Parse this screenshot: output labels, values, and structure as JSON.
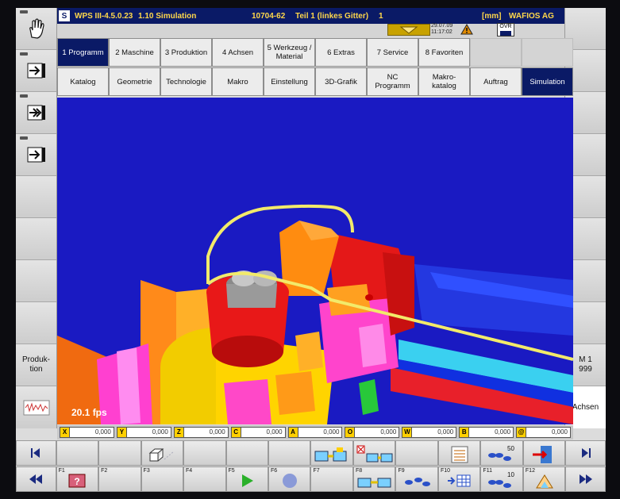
{
  "titlebar": {
    "app": "WPS III-4.5.0.23",
    "screen": "1.10 Simulation",
    "part_no": "10704-62",
    "part_name": "Teil 1 (linkes Gitter)",
    "part_index": "1",
    "unit": "[mm]",
    "company": "WAFIOS AG"
  },
  "status": {
    "date": "29.07.09",
    "time": "11:17:02",
    "ovr_label": "OVR"
  },
  "top_tabs": [
    {
      "label": "1 Programm",
      "selected": true
    },
    {
      "label": "2 Maschine"
    },
    {
      "label": "3 Produktion"
    },
    {
      "label": "4 Achsen"
    },
    {
      "label": "5 Werkzeug / Material"
    },
    {
      "label": "6 Extras"
    },
    {
      "label": "7 Service"
    },
    {
      "label": "8 Favoriten"
    }
  ],
  "sub_tabs": [
    {
      "label": "Katalog"
    },
    {
      "label": "Geometrie"
    },
    {
      "label": "Technologie"
    },
    {
      "label": "Makro"
    },
    {
      "label": "Einstellung"
    },
    {
      "label": "3D-Grafik"
    },
    {
      "label": "NC Programm"
    },
    {
      "label": "Makro-katalog"
    },
    {
      "label": "Auftrag"
    },
    {
      "label": "Simulation",
      "selected": true
    }
  ],
  "left_softkeys": [
    {
      "icon": "hand-icon"
    },
    {
      "icon": "step-forward-icon"
    },
    {
      "icon": "double-step-icon"
    },
    {
      "icon": "arrow-in-icon"
    },
    {
      "label": ""
    },
    {
      "label": ""
    },
    {
      "label": ""
    },
    {
      "label": ""
    },
    {
      "label": "Produk-tion"
    },
    {
      "icon": "chart-icon"
    }
  ],
  "right_softkeys": [
    {
      "label": ""
    },
    {
      "label": ""
    },
    {
      "label": ""
    },
    {
      "label": ""
    },
    {
      "label": ""
    },
    {
      "label": ""
    },
    {
      "label": ""
    },
    {
      "label": ""
    },
    {
      "label": "M 1 999"
    },
    {
      "label": "Achsen"
    }
  ],
  "viewport": {
    "fps": "20.1 fps"
  },
  "axes": [
    {
      "name": "X",
      "value": "0,000"
    },
    {
      "name": "Y",
      "value": "0,000"
    },
    {
      "name": "Z",
      "value": "0,000"
    },
    {
      "name": "C",
      "value": "0,000"
    },
    {
      "name": "A",
      "value": "0,000"
    },
    {
      "name": "O",
      "value": "0,000"
    },
    {
      "name": "W",
      "value": "0,000"
    },
    {
      "name": "B",
      "value": "0,000"
    },
    {
      "name": "@",
      "value": "0,000"
    }
  ],
  "fkeys_row1": [
    {
      "fn": "",
      "icon": "cube-icon"
    },
    {
      "fn": "",
      "icon": "machine-transfer-icon"
    },
    {
      "fn": "",
      "icon": "machine-cancel-icon"
    },
    {
      "fn": "",
      "icon": "list-icon"
    },
    {
      "fn": "",
      "icon": "speed-icon",
      "num": "50"
    },
    {
      "fn": "",
      "icon": "exit-door-icon"
    }
  ],
  "fkeys_row2": [
    {
      "fn": "F1",
      "icon": "help-icon"
    },
    {
      "fn": "F2"
    },
    {
      "fn": "F3"
    },
    {
      "fn": "F4"
    },
    {
      "fn": "F5",
      "icon": "play-icon"
    },
    {
      "fn": "F6",
      "icon": "stop-icon"
    },
    {
      "fn": "F7"
    },
    {
      "fn": "F8",
      "icon": "machine-icon"
    },
    {
      "fn": "F9",
      "icon": "feet-icon"
    },
    {
      "fn": "F10",
      "icon": "grid-icon"
    },
    {
      "fn": "F11",
      "icon": "speed-icon",
      "num": "10"
    },
    {
      "fn": "F12",
      "icon": "tools-icon"
    }
  ],
  "colors": {
    "title_bg": "#0a1a66",
    "title_fg": "#ffd84a",
    "viewport_bg": "#1a1ac2",
    "wire": "#f2ea6a",
    "selected_tab": "#0a1a66"
  }
}
